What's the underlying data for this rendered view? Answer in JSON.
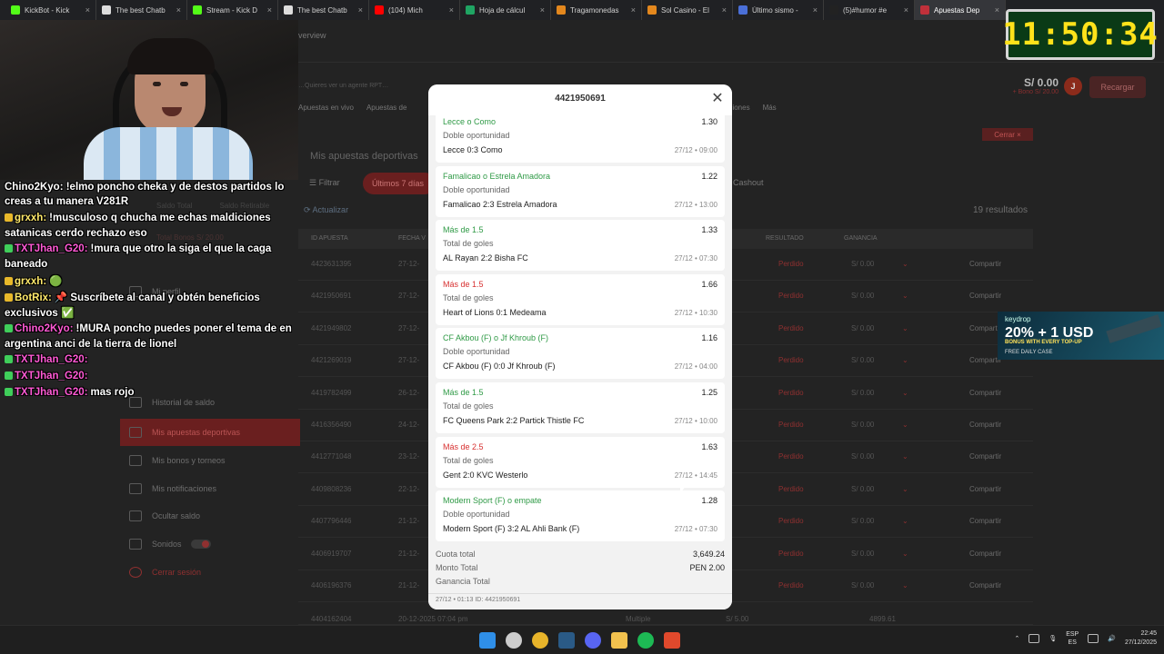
{
  "browser": {
    "tabs": [
      {
        "title": "KickBot - Kick",
        "icon": "kick-icon",
        "color": "#53fc18"
      },
      {
        "title": "The best Chatb",
        "icon": "chatgpt-icon",
        "color": "#dddddd"
      },
      {
        "title": "Stream - Kick D",
        "icon": "kick-icon",
        "color": "#53fc18"
      },
      {
        "title": "The best Chatb",
        "icon": "chatgpt-icon",
        "color": "#dddddd"
      },
      {
        "title": "(104) Mich",
        "icon": "youtube-icon",
        "color": "#ff0000"
      },
      {
        "title": "Hoja de cálcul",
        "icon": "sheets-icon",
        "color": "#1fa463"
      },
      {
        "title": "Tragamonedas",
        "icon": "site-icon",
        "color": "#e3871d"
      },
      {
        "title": "Sol Casino - El",
        "icon": "site-icon",
        "color": "#e3871d"
      },
      {
        "title": "Último sismo -",
        "icon": "site-icon",
        "color": "#4a6fd8"
      },
      {
        "title": "(5)#humor #e",
        "icon": "tiktok-icon",
        "color": "#222222"
      },
      {
        "title": "Apuestas Dep",
        "icon": "site-icon",
        "color": "#c0303a",
        "active": true
      }
    ]
  },
  "site": {
    "breadcrumb": "verview",
    "notice": "…Quieres ver un agente RPT…",
    "balance": "S/ 0.00",
    "bonus": "+ Bono S/ 20.00",
    "avatar_initial": "J",
    "recharge_label": "Recargar",
    "nav": [
      "Apuestas en vivo",
      "Apuestas de",
      "es",
      "Promociones",
      "Más"
    ],
    "close_label": "Cerrar ×",
    "page_title": "Mis apuestas deportivas",
    "filter_label": "Filtrar",
    "last_days_label": "Últimos 7 días",
    "cashout_label": "Cashout",
    "refresh_label": "Actualizar",
    "results_label": "19 resultados",
    "saldo_total": "Saldo Total",
    "saldo_retirable": "Saldo Retirable",
    "total_bonos": "Total Bonos S/ 20.00",
    "table_headers": {
      "id": "ID APUESTA",
      "fecha": "FECHA V",
      "resultado": "RESULTADO",
      "ganancia": "GANANCIA"
    },
    "rows": [
      {
        "id": "4423631395",
        "fecha": "27-12-",
        "result": "Perdido",
        "gain": "S/ 0.00",
        "share": "Compartir"
      },
      {
        "id": "4421950691",
        "fecha": "27-12-",
        "result": "Perdido",
        "gain": "S/ 0.00",
        "share": "Compartir"
      },
      {
        "id": "4421949802",
        "fecha": "27-12-",
        "result": "Perdido",
        "gain": "S/ 0.00",
        "share": "Compartir"
      },
      {
        "id": "4421269019",
        "fecha": "27-12-",
        "result": "Perdido",
        "gain": "S/ 0.00",
        "share": "Compartir"
      },
      {
        "id": "4419782499",
        "fecha": "26-12-",
        "result": "Perdido",
        "gain": "S/ 0.00",
        "share": "Compartir"
      },
      {
        "id": "4416356490",
        "fecha": "24-12-",
        "result": "Perdido",
        "gain": "S/ 0.00",
        "share": "Compartir"
      },
      {
        "id": "4412771048",
        "fecha": "23-12-",
        "result": "Perdido",
        "gain": "S/ 0.00",
        "share": "Compartir"
      },
      {
        "id": "4409808236",
        "fecha": "22-12-",
        "result": "Perdido",
        "gain": "S/ 0.00",
        "share": "Compartir"
      },
      {
        "id": "4407796446",
        "fecha": "21-12-",
        "result": "Perdido",
        "gain": "S/ 0.00",
        "share": "Compartir"
      },
      {
        "id": "4406919707",
        "fecha": "21-12-",
        "result": "Perdido",
        "gain": "S/ 0.00",
        "share": "Compartir"
      },
      {
        "id": "4406196376",
        "fecha": "21-12-",
        "result": "Perdido",
        "gain": "S/ 0.00",
        "share": "Compartir"
      }
    ],
    "last_row": {
      "id": "4404162404",
      "fecha": "20-12-2025 07:04 pm",
      "type": "Multiple",
      "stake": "S/ 5.00",
      "gain": "4899.61"
    },
    "sidebar": [
      {
        "label": "Mi perfil",
        "icon": "user-icon"
      },
      {
        "label": "Historial de saldo",
        "icon": "history-icon"
      },
      {
        "label": "Mis apuestas deportivas",
        "icon": "ticket-icon",
        "active": true
      },
      {
        "label": "Mis bonos y torneos",
        "icon": "gift-icon"
      },
      {
        "label": "Mis notificaciones",
        "icon": "mail-icon"
      },
      {
        "label": "Ocultar saldo",
        "icon": "eye-off-icon"
      },
      {
        "label": "Sonidos",
        "icon": "sound-icon",
        "toggle": true
      },
      {
        "label": "Cerrar sesión",
        "icon": "power-icon",
        "logout": true
      }
    ]
  },
  "stream": {
    "timer": "11:50:34",
    "chat": [
      {
        "user": "",
        "text": "Chino2Kyo: !elmo poncho cheka y de destos partidos lo"
      },
      {
        "user": "",
        "text": "creas a tu manera V281R"
      },
      {
        "user": "grxxh:",
        "text": "!musculoso q chucha me echas maldiciones satanicas cerdo rechazo eso",
        "color": "#ffe96b"
      },
      {
        "user": "TXTJhan_G20:",
        "text": "!mura que otro la siga el que la caga baneado",
        "color": "#ff5ad5"
      },
      {
        "user": "grxxh:",
        "text": "🟢",
        "color": "#ffe96b"
      },
      {
        "user": "BotRix:",
        "text": "📌 Suscríbete al canal y obtén beneficios exclusivos ✅",
        "color": "#ffe96b"
      },
      {
        "user": "Chino2Kyo:",
        "text": "!MURA poncho puedes poner el tema de en argentina anci de la tierra de lionel",
        "color": "#ff5ad5"
      },
      {
        "user": "TXTJhan_G20:",
        "text": "",
        "color": "#ff5ad5"
      },
      {
        "user": "TXTJhan_G20:",
        "text": "",
        "color": "#ff5ad5"
      },
      {
        "user": "TXTJhan_G20:",
        "text": "mas rojo",
        "color": "#ff5ad5"
      }
    ],
    "ad": {
      "brand": "keydrop",
      "headline": "20% + 1 USD",
      "sub": "BONUS WITH EVERY TOP-UP",
      "cta": "FREE DAILY CASE"
    }
  },
  "modal": {
    "title": "4421950691",
    "selections": [
      {
        "pick": "Lecce o Como",
        "odds": "1.30",
        "market": "Doble oportunidad",
        "event": "Lecce 0:3 Como",
        "date": "27/12 • 09:00",
        "status": "won"
      },
      {
        "pick": "Famalicao o Estrela Amadora",
        "odds": "1.22",
        "market": "Doble oportunidad",
        "event": "Famalicao 2:3 Estrela Amadora",
        "date": "27/12 • 13:00",
        "status": "won"
      },
      {
        "pick": "Más de 1.5",
        "odds": "1.33",
        "market": "Total de goles",
        "event": "AL Rayan 2:2 Bisha FC",
        "date": "27/12 • 07:30",
        "status": "won"
      },
      {
        "pick": "Más de 1.5",
        "odds": "1.66",
        "market": "Total de goles",
        "event": "Heart of Lions 0:1 Medeama",
        "date": "27/12 • 10:30",
        "status": "lost"
      },
      {
        "pick": "CF Akbou (F) o Jf Khroub (F)",
        "odds": "1.16",
        "market": "Doble oportunidad",
        "event": "CF Akbou (F) 0:0 Jf Khroub (F)",
        "date": "27/12 • 04:00",
        "status": "won"
      },
      {
        "pick": "Más de 1.5",
        "odds": "1.25",
        "market": "Total de goles",
        "event": "FC Queens Park 2:2 Partick Thistle FC",
        "date": "27/12 • 10:00",
        "status": "won"
      },
      {
        "pick": "Más de 2.5",
        "odds": "1.63",
        "market": "Total de goles",
        "event": "Gent 2:0 KVC Westerlo",
        "date": "27/12 • 14:45",
        "status": "lost"
      },
      {
        "pick": "Modern Sport (F) o empate",
        "odds": "1.28",
        "market": "Doble oportunidad",
        "event": "Modern Sport (F) 3:2 AL Ahli Bank (F)",
        "date": "27/12 • 07:30",
        "status": "won"
      }
    ],
    "footer": {
      "cuota_label": "Cuota total",
      "cuota_value": "3,649.24",
      "monto_label": "Monto Total",
      "monto_value": "PEN 2.00",
      "ganancia_label": "Ganancia Total",
      "meta": "27/12 • 01:13   ID: 4421950691"
    }
  },
  "taskbar": {
    "apps": [
      {
        "icon": "windows-start-icon",
        "color": "#2f8fe8"
      },
      {
        "icon": "search-icon",
        "color": "#cccccc"
      },
      {
        "icon": "chrome-icon",
        "color": "#e8b42a"
      },
      {
        "icon": "steam-icon",
        "color": "#2a5a86"
      },
      {
        "icon": "discord-icon",
        "color": "#5865f2"
      },
      {
        "icon": "folder-icon",
        "color": "#f2c14e"
      },
      {
        "icon": "spotify-icon",
        "color": "#1db954"
      },
      {
        "icon": "brave-icon",
        "color": "#e0492c"
      }
    ],
    "lang_top": "ESP",
    "lang_bottom": "ES",
    "time": "22:45",
    "date": "27/12/2025"
  }
}
